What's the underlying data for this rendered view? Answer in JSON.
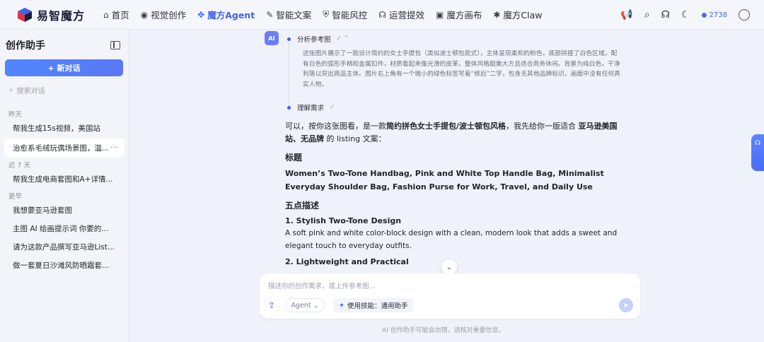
{
  "app": {
    "name": "易智魔方"
  },
  "nav": {
    "items": [
      {
        "label": "首页",
        "icon": "home-icon",
        "glyph": "⌂"
      },
      {
        "label": "视觉创作",
        "icon": "eye-icon",
        "glyph": "◉"
      },
      {
        "label": "魔方Agent",
        "icon": "agent-icon",
        "glyph": "✥",
        "active": true
      },
      {
        "label": "智能文案",
        "icon": "pen-icon",
        "glyph": "✎"
      },
      {
        "label": "智能风控",
        "icon": "shield-icon",
        "glyph": "⛨"
      },
      {
        "label": "运营提效",
        "icon": "headset-icon",
        "glyph": "☊"
      },
      {
        "label": "魔方画布",
        "icon": "canvas-icon",
        "glyph": "▣"
      },
      {
        "label": "魔方Claw",
        "icon": "claw-icon",
        "glyph": "✱"
      }
    ],
    "credits": "2738"
  },
  "sidebar": {
    "title": "创作助手",
    "new_chat": "+ 新对话",
    "search_placeholder": "搜索对话",
    "groups": [
      {
        "label": "昨天",
        "items": [
          "帮我生成15s视频，美国站",
          "治愈系毛绒玩偶场景图，温..."
        ]
      },
      {
        "label": "近 7 天",
        "items": [
          "帮我生成电商套图和A+详情..."
        ]
      },
      {
        "label": "更早",
        "items": [
          "我想要亚马逊套图",
          "主图 AI 绘画提示词 你要的...",
          "请为这款产品撰写亚马逊List...",
          "做一套夏日沙滩风防晒霜套..."
        ]
      }
    ]
  },
  "chat": {
    "ai_badge": "AI",
    "step1_label": "分析参考图",
    "analysis_text": "这张图片展示了一款设计简约的女士手提包（类似波士顿包款式），主体呈现柔和的粉色，底部拼接了白色区域，配有白色的弧形手柄和金属扣件，材质看起来像光滑的皮革，整体风格甜美大方且适合商务休闲。背景为纯白色，干净利落以突出商品主体。图片右上角有一个微小的绿色标签写着“修后”二字，包身无其他品牌标识，画面中没有任何真实人物。",
    "step2_label": "理解需求",
    "intro_a": "可以，按你这张图看，是一款",
    "intro_b": "简约拼色女士手提包/波士顿包风格",
    "intro_c": "，我先给你一版适合 ",
    "intro_d": "亚马逊美国站、无品牌",
    "intro_e": " 的 listing 文案：",
    "title_heading": "标题",
    "title_text": "Women’s Two-Tone Handbag, Pink and White Top Handle Bag, Minimalist Everyday Shoulder Bag, Fashion Purse for Work, Travel, and Daily Use",
    "bullets_heading": "五点描述",
    "bullet1_title": "1. Stylish Two-Tone Design",
    "bullet1_text": "A soft pink and white color-block design with a clean, modern look that adds a sweet and elegant touch to everyday outfits.",
    "bullet2_title": "2. Lightweight and Practical"
  },
  "composer": {
    "placeholder": "描述你的创作需求，或上传参考图…",
    "agent_label": "Agent",
    "skill_label": "使用技能：通用助手",
    "disclaimer": "AI 创作助手可能会出错，请核对重要信息。"
  },
  "colors": {
    "accent": "#3d63f0",
    "sidebar_bg": "#f3f4f9",
    "main_bg": "#f0f2fb"
  }
}
